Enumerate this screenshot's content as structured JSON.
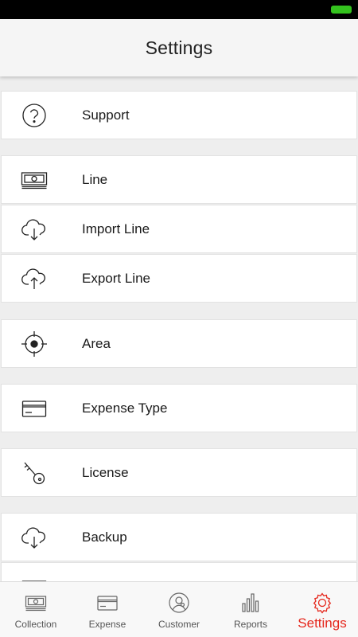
{
  "header": {
    "title": "Settings"
  },
  "settings_items": [
    {
      "label": "Support",
      "icon": "help-circle-icon"
    },
    {
      "label": "Line",
      "icon": "money-icon"
    },
    {
      "label": "Import Line",
      "icon": "cloud-download-icon"
    },
    {
      "label": "Export Line",
      "icon": "cloud-upload-icon"
    },
    {
      "label": "Area",
      "icon": "target-icon"
    },
    {
      "label": "Expense Type",
      "icon": "credit-card-icon"
    },
    {
      "label": "License",
      "icon": "key-icon"
    },
    {
      "label": "Backup",
      "icon": "cloud-download-icon"
    }
  ],
  "tabs": [
    {
      "label": "Collection",
      "icon": "money-icon",
      "active": false
    },
    {
      "label": "Expense",
      "icon": "card-icon",
      "active": false
    },
    {
      "label": "Customer",
      "icon": "customer-icon",
      "active": false
    },
    {
      "label": "Reports",
      "icon": "bar-chart-icon",
      "active": false
    },
    {
      "label": "Settings",
      "icon": "gear-icon",
      "active": true
    }
  ],
  "colors": {
    "accent": "#e5271c",
    "battery": "#34c21e",
    "header_bg": "#f5f5f5",
    "page_bg": "#eeeeee"
  }
}
